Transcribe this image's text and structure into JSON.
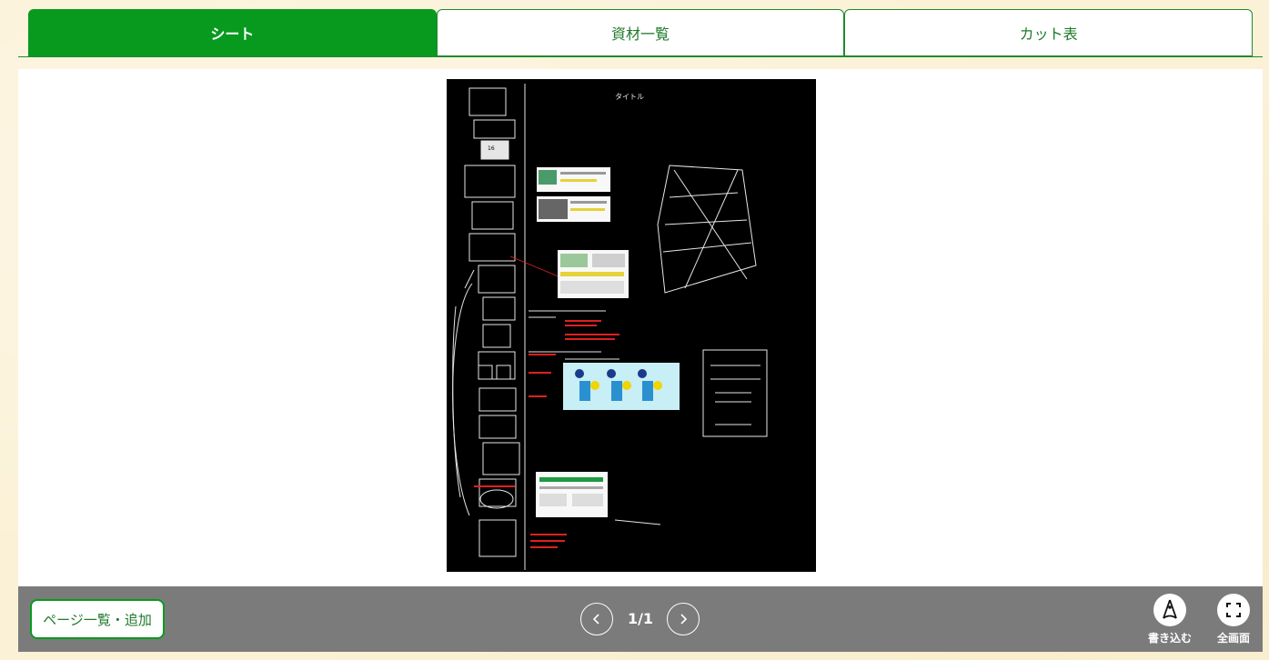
{
  "tabs": [
    {
      "label": "シート",
      "active": true
    },
    {
      "label": "資材一覧",
      "active": false
    },
    {
      "label": "カット表",
      "active": false
    }
  ],
  "bottom_bar": {
    "page_list_label": "ページ一覧・追加",
    "page_indicator": "1/1",
    "prev_icon": "chevron-left-icon",
    "next_icon": "chevron-right-icon",
    "write_label": "書き込む",
    "write_icon": "pen-nib-icon",
    "fullscreen_label": "全画面",
    "fullscreen_icon": "fullscreen-icon"
  },
  "colors": {
    "accent": "#089a1f",
    "tab_text": "#1f7a2a",
    "bar": "#7b7b7b",
    "page_bg": "#fbf1d6",
    "sheet_bg": "#000000"
  }
}
